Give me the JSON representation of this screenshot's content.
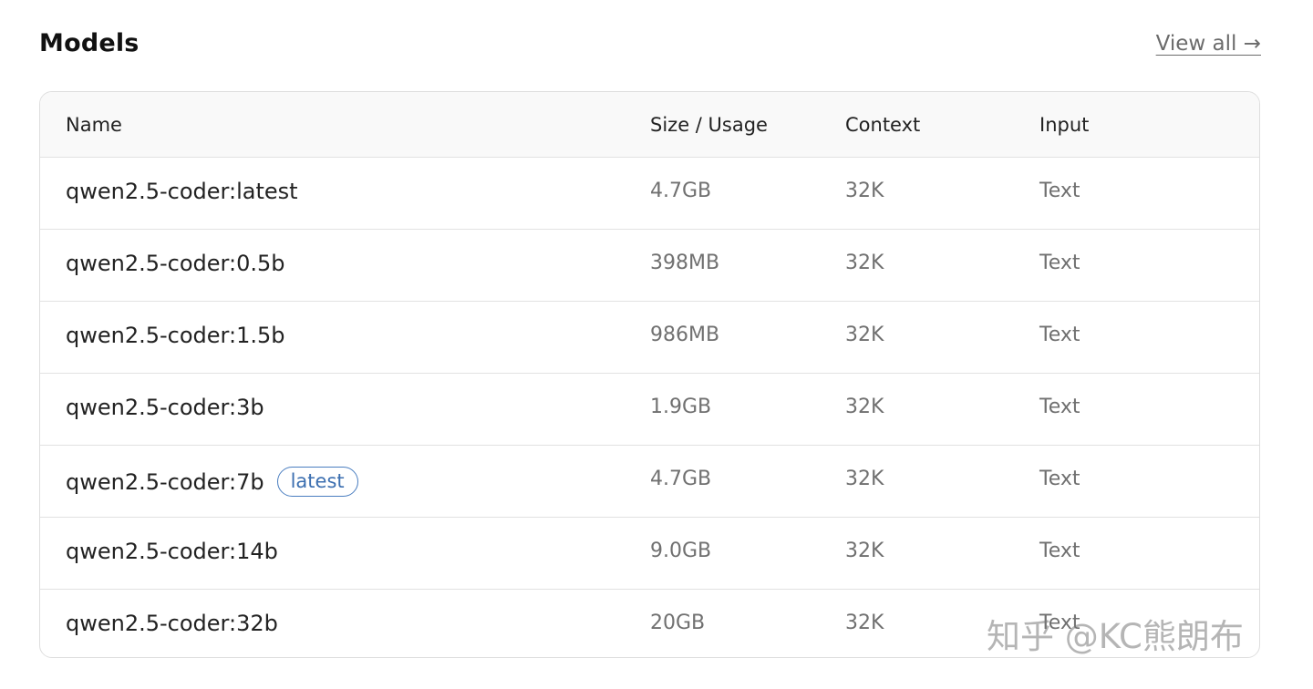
{
  "section": {
    "title": "Models",
    "view_all": "View all →"
  },
  "table": {
    "headers": {
      "name": "Name",
      "size": "Size / Usage",
      "context": "Context",
      "input": "Input"
    },
    "rows": [
      {
        "name": "qwen2.5-coder:latest",
        "size": "4.7GB",
        "context": "32K",
        "input": "Text",
        "badge": ""
      },
      {
        "name": "qwen2.5-coder:0.5b",
        "size": "398MB",
        "context": "32K",
        "input": "Text",
        "badge": ""
      },
      {
        "name": "qwen2.5-coder:1.5b",
        "size": "986MB",
        "context": "32K",
        "input": "Text",
        "badge": ""
      },
      {
        "name": "qwen2.5-coder:3b",
        "size": "1.9GB",
        "context": "32K",
        "input": "Text",
        "badge": ""
      },
      {
        "name": "qwen2.5-coder:7b",
        "size": "4.7GB",
        "context": "32K",
        "input": "Text",
        "badge": "latest"
      },
      {
        "name": "qwen2.5-coder:14b",
        "size": "9.0GB",
        "context": "32K",
        "input": "Text",
        "badge": ""
      },
      {
        "name": "qwen2.5-coder:32b",
        "size": "20GB",
        "context": "32K",
        "input": "Text",
        "badge": ""
      }
    ]
  },
  "watermark": "知乎 @KC熊朗布",
  "colors": {
    "badge_accent": "#3c6fb0",
    "header_bg": "#f9f9f9",
    "border": "#dedede"
  }
}
